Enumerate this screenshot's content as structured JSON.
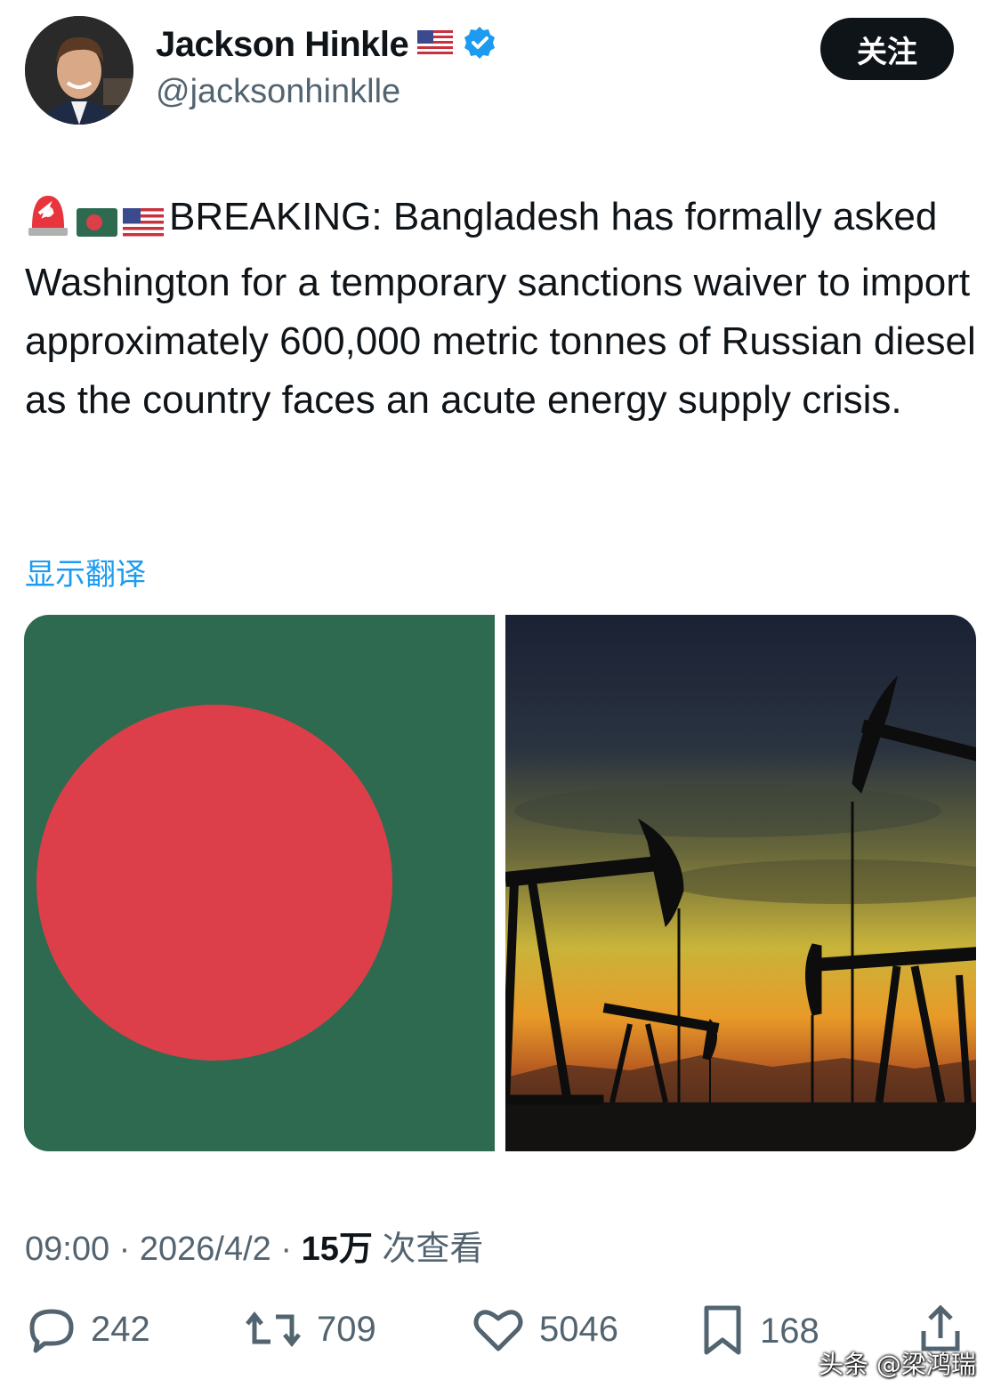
{
  "author": {
    "name": "Jackson Hinkle",
    "handle": "@jacksonhinklle",
    "verified": true,
    "name_flag_icon": "us-flag-icon"
  },
  "follow_button": {
    "label": "关注"
  },
  "tweet": {
    "leading_emojis": [
      "police-light-icon",
      "bangladesh-flag-icon",
      "us-flag-icon"
    ],
    "text": "BREAKING: Bangladesh has formally asked Washington for a temporary sanctions waiver to import approximately 600,000 metric tonnes of Russian diesel as the country faces an acute energy supply crisis."
  },
  "translate_link": "显示翻译",
  "media": [
    {
      "kind": "bangladesh-flag-image"
    },
    {
      "kind": "oil-pumpjacks-sunset-image"
    }
  ],
  "meta": {
    "time": "09:00",
    "date": "2026/4/2",
    "views_count": "15万",
    "views_label": "次查看"
  },
  "actions": {
    "replies": "242",
    "reposts": "709",
    "likes": "5046",
    "bookmarks": "168"
  },
  "watermark": "头条 @梁鸿瑞",
  "colors": {
    "accent": "#1d9bf0",
    "muted": "#536471",
    "flag_green": "#2d6a4f",
    "flag_red": "#dc3f4a"
  }
}
